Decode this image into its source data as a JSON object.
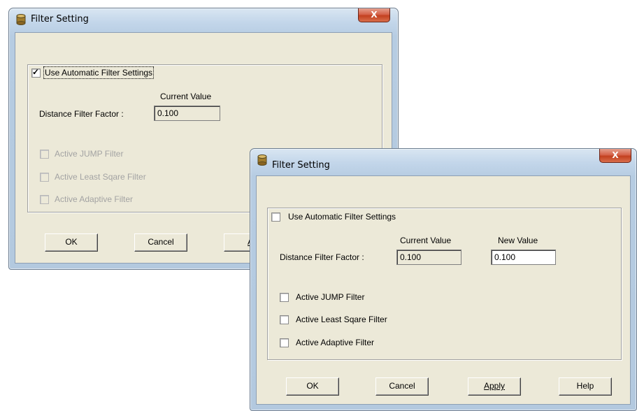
{
  "back_dialog": {
    "title": "Filter Setting",
    "close_glyph": "X",
    "use_auto_label": "Use Automatic Filter Settings",
    "use_auto_checked": true,
    "current_value_header": "Current Value",
    "distance_label": "Distance Filter Factor :",
    "distance_current": "0.100",
    "filters": [
      {
        "label": "Active JUMP Filter",
        "checked": false,
        "enabled": false
      },
      {
        "label": "Active Least Sqare Filter",
        "checked": false,
        "enabled": false
      },
      {
        "label": "Active Adaptive Filter",
        "checked": false,
        "enabled": false
      }
    ],
    "buttons": {
      "ok": "OK",
      "cancel": "Cancel",
      "apply_partial": "A"
    }
  },
  "front_dialog": {
    "title": "Filter Setting",
    "close_glyph": "X",
    "use_auto_label": "Use Automatic Filter Settings",
    "use_auto_checked": false,
    "current_value_header": "Current Value",
    "new_value_header": "New Value",
    "distance_label": "Distance Filter Factor :",
    "distance_current": "0.100",
    "distance_new": "0.100",
    "filters": [
      {
        "label": "Active JUMP Filter",
        "checked": false,
        "enabled": true
      },
      {
        "label": "Active Least Sqare Filter",
        "checked": false,
        "enabled": true
      },
      {
        "label": "Active Adaptive Filter",
        "checked": false,
        "enabled": true
      }
    ],
    "buttons": {
      "ok": "OK",
      "cancel": "Cancel",
      "apply": "Apply",
      "help": "Help"
    }
  },
  "icons": {
    "title_icon": "database-cylinder-icon",
    "close_icon": "close-x-icon",
    "checkmark": "checkmark-icon"
  }
}
